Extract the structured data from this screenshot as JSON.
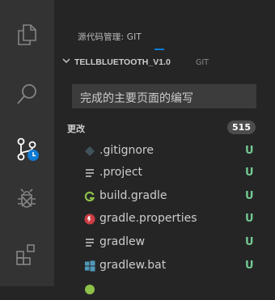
{
  "panel": {
    "title": "源代码管理: GIT"
  },
  "repo": {
    "name": "TELLBLUETOOTH_V1.0",
    "provider": "GIT"
  },
  "commit": {
    "message": "完成的主要页面的编写"
  },
  "changes": {
    "label": "更改",
    "count": "515"
  },
  "files": [
    {
      "name": ".gitignore",
      "icon": "gitignore-icon",
      "status": "U"
    },
    {
      "name": ".project",
      "icon": "lines-icon",
      "status": "U"
    },
    {
      "name": "build.gradle",
      "icon": "gradle-icon",
      "status": "U"
    },
    {
      "name": "gradle.properties",
      "icon": "properties-icon",
      "status": "U"
    },
    {
      "name": "gradlew",
      "icon": "lines-icon",
      "status": "U"
    },
    {
      "name": "gradlew.bat",
      "icon": "windows-icon",
      "status": "U"
    }
  ],
  "colors": {
    "activity_bar": "#333333",
    "side_bar": "#252526",
    "input": "#3c3c3c",
    "untracked": "#73c991",
    "accent": "#0e7ad3"
  }
}
